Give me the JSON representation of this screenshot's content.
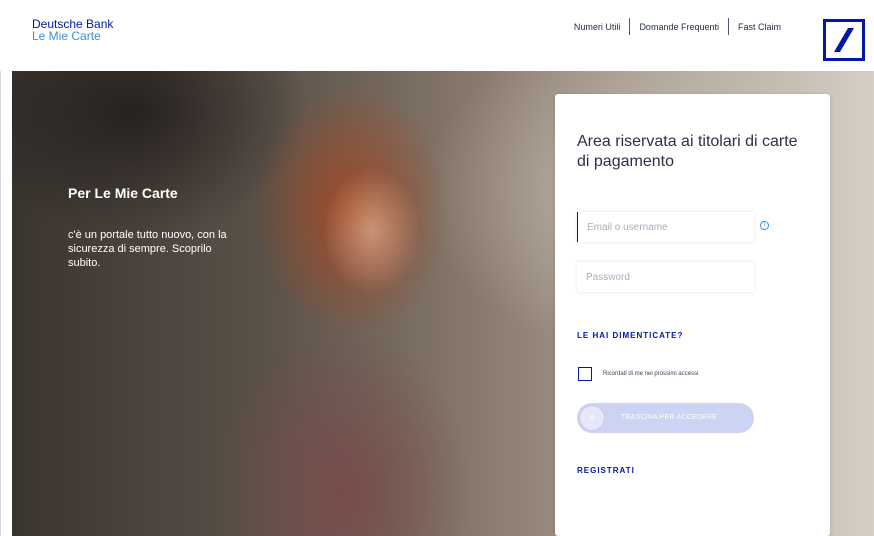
{
  "header": {
    "brand_line1": "Deutsche Bank",
    "brand_line2": "Le Mie Carte",
    "nav": [
      "Numeri Utili",
      "Domande Frequenti",
      "Fast Claim"
    ],
    "logo_icon": "deutsche-bank-slash-logo"
  },
  "hero": {
    "title": "Per Le Mie Carte",
    "text": "c'è un portale tutto nuovo, con la sicurezza di sempre. Scoprilo subito."
  },
  "login": {
    "title": "Area riservata ai titolari di carte di pagamento",
    "email_placeholder": "Email o username",
    "password_placeholder": "Password",
    "info_icon": "i",
    "forgot_label": "LE HAI DIMENTICATE?",
    "remember_label": "Ricordati di me nei prossimi accessi",
    "slider_label": "TRASCINA PER ACCEDERE",
    "slider_icon": "»",
    "register_label": "REGISTRATI"
  },
  "colors": {
    "brand_blue": "#0018a8",
    "light_blue": "#3a8fd9",
    "slider_bg": "#cdd3f2"
  }
}
